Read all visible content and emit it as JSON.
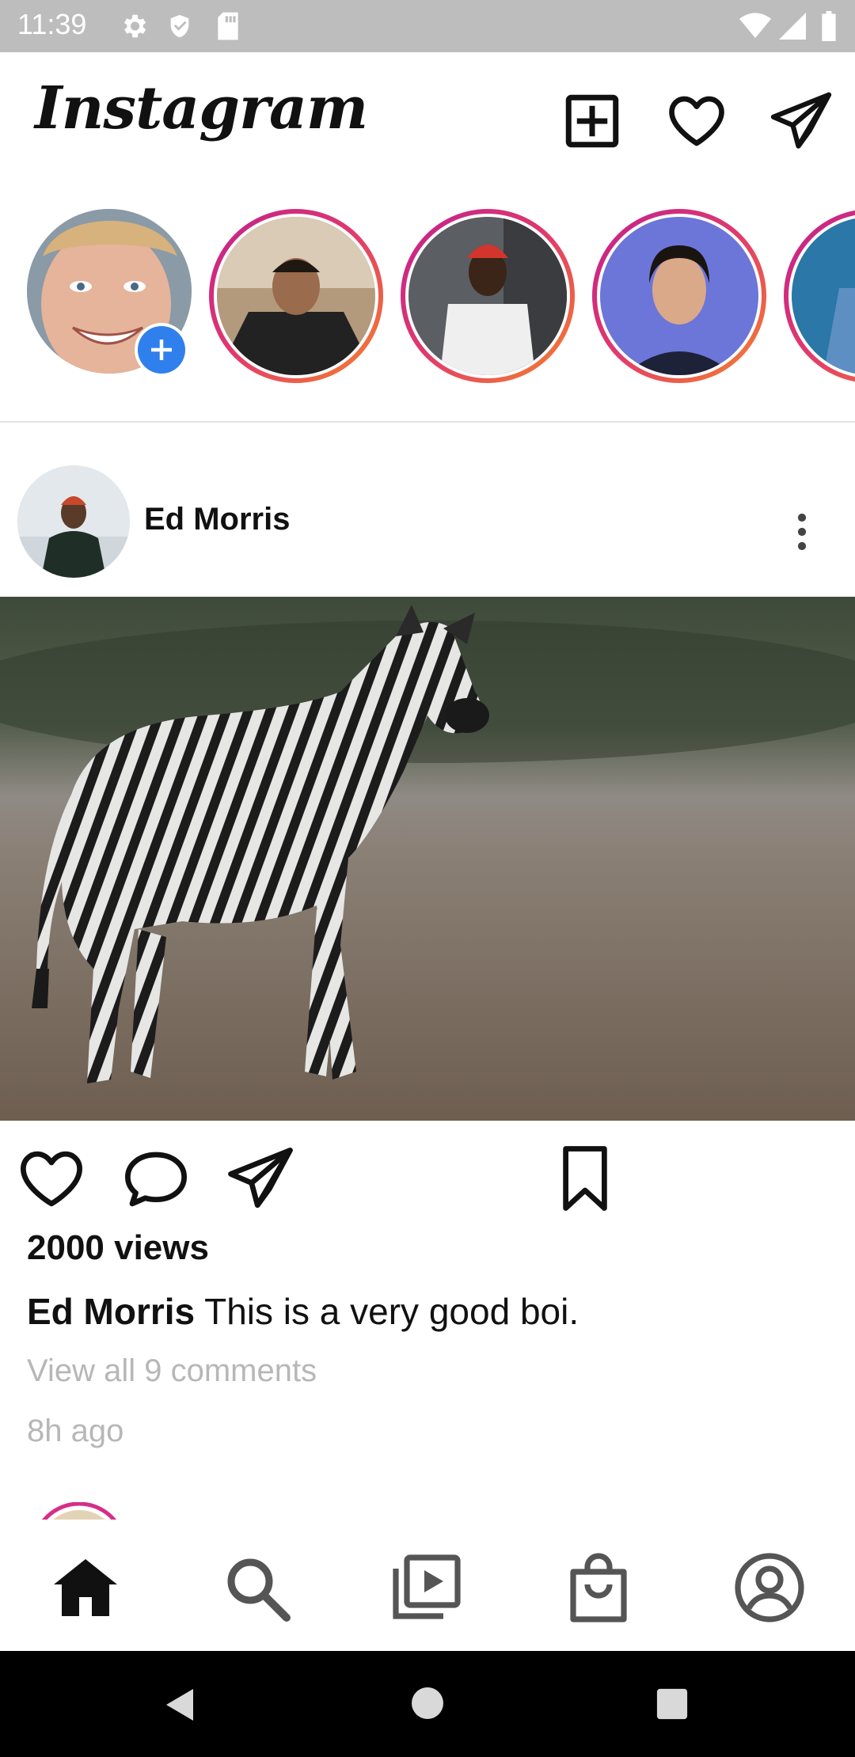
{
  "status_bar": {
    "time": "11:39",
    "icons": [
      "settings-icon",
      "shield-icon",
      "sd-card-icon",
      "wifi-icon",
      "signal-icon",
      "battery-icon"
    ]
  },
  "header": {
    "logo_text": "Instagram",
    "icons": [
      "add-post-icon",
      "heart-icon",
      "send-icon"
    ]
  },
  "stories": [
    {
      "kind": "own",
      "badge_icon": "add-story-icon"
    },
    {
      "kind": "friend"
    },
    {
      "kind": "friend"
    },
    {
      "kind": "friend"
    },
    {
      "kind": "friend"
    }
  ],
  "post": {
    "author": "Ed Morris",
    "views": "2000 views",
    "caption_author": "Ed Morris",
    "caption_text": " This is a very good boi.",
    "view_comments": "View all 9 comments",
    "time_ago": "8h ago",
    "actions": [
      "like-icon",
      "comment-icon",
      "share-icon",
      "bookmark-icon"
    ]
  },
  "bottom_nav": [
    "home-icon",
    "search-icon",
    "reels-icon",
    "shop-icon",
    "profile-icon"
  ],
  "colors": {
    "status_bar": "#bdbdbd",
    "story_ring_start": "#c0208f",
    "story_ring_end": "#f58529",
    "add_badge": "#2f80ed",
    "secondary_text": "#b7b7b7"
  }
}
